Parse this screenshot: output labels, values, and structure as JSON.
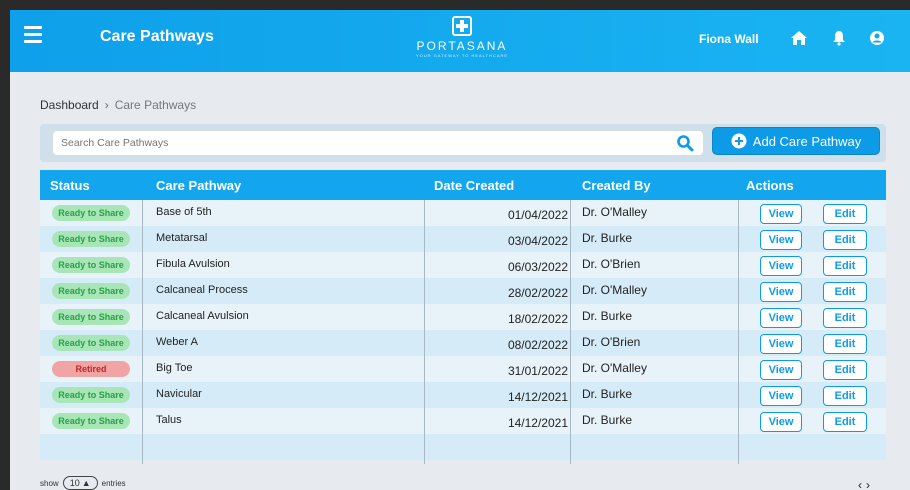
{
  "header": {
    "title": "Care Pathways",
    "logo_text": "PORTASANA",
    "logo_tag": "YOUR GATEWAY TO HEALTHCARE",
    "user": "Fiona Wall",
    "icons": [
      "menu-icon",
      "home-icon",
      "bell-icon",
      "user-icon"
    ]
  },
  "breadcrumb": {
    "root": "Dashboard",
    "current": "Care Pathways"
  },
  "search": {
    "placeholder": "Search Care Pathways"
  },
  "add_button": "Add Care Pathway",
  "columns": {
    "status": "Status",
    "pathway": "Care Pathway",
    "date": "Date Created",
    "by": "Created By",
    "actions": "Actions"
  },
  "rows": [
    {
      "status": "Ready to Share",
      "pathway": "Base of 5th",
      "date": "01/04/2022",
      "by": "Dr. O'Malley"
    },
    {
      "status": "Ready to Share",
      "pathway": "Metatarsal",
      "date": "03/04/2022",
      "by": "Dr. Burke"
    },
    {
      "status": "Ready to Share",
      "pathway": "Fibula Avulsion",
      "date": "06/03/2022",
      "by": "Dr. O'Brien"
    },
    {
      "status": "Ready to Share",
      "pathway": "Calcaneal Process",
      "date": "28/02/2022",
      "by": "Dr. O'Malley"
    },
    {
      "status": "Ready to Share",
      "pathway": "Calcaneal Avulsion",
      "date": "18/02/2022",
      "by": "Dr. Burke"
    },
    {
      "status": "Ready to Share",
      "pathway": "Weber A",
      "date": "08/02/2022",
      "by": "Dr. O'Brien"
    },
    {
      "status": "Retired",
      "pathway": "Big Toe",
      "date": "31/01/2022",
      "by": "Dr. O'Malley"
    },
    {
      "status": "Ready to Share",
      "pathway": "Navicular",
      "date": "14/12/2021",
      "by": "Dr. Burke"
    },
    {
      "status": "Ready to Share",
      "pathway": "Talus",
      "date": "14/12/2021",
      "by": "Dr. Burke"
    }
  ],
  "actions": {
    "view": "View",
    "edit": "Edit"
  },
  "footer": {
    "show_label": "show",
    "entries_value": "10",
    "entries_label": "entries"
  },
  "colors": {
    "primary": "#0d9be8",
    "ready": "#28a045",
    "retired": "#c0262c"
  }
}
